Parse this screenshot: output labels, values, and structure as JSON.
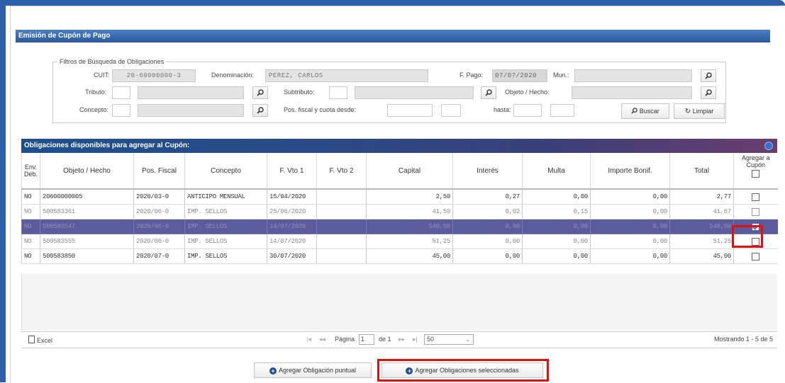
{
  "panel": {
    "title": "Emisión de Cupón de Pago"
  },
  "filters": {
    "legend": "Filtros de Búsqueda de Obligaciones",
    "cuit_label": "CUIT:",
    "cuit_value": "20-60000000-3",
    "denominacion_label": "Denominación:",
    "denominacion_value": "PEREZ, CARLOS",
    "fpago_label": "F. Pago:",
    "fpago_value": "07/07/2020",
    "mun_label": "Mun.:",
    "tributo_label": "Tributo:",
    "subtributo_label": "Subtributo:",
    "objeto_label": "Objeto / Hecho:",
    "concepto_label": "Concepto:",
    "posfiscal_label": "Pos. fiscal y cuota desde:",
    "hasta_label": "hasta:",
    "buscar_label": "Buscar",
    "limpiar_label": "Limpiar"
  },
  "grid": {
    "title": "Obligaciones disponibles para agregar al Cupón:",
    "columns": [
      "Env. Déb.",
      "Objeto / Hecho",
      "Pos. Fiscal",
      "Concepto",
      "F. Vto 1",
      "F. Vto 2",
      "Capital",
      "Interés",
      "Multa",
      "Importe Bonif.",
      "Total",
      "Agregar a Cupón"
    ],
    "rows": [
      {
        "env": "NO",
        "objeto": "20600000005",
        "pos": "2020/03-0",
        "concepto": "ANTICIPO MENSUAL",
        "fvto1": "15/04/2020",
        "fvto2": "",
        "capital": "2,50",
        "interes": "0,27",
        "multa": "0,00",
        "bonif": "0,00",
        "total": "2,77",
        "checked": false
      },
      {
        "env": "NO",
        "objeto": "500583361",
        "pos": "2020/06-0",
        "concepto": "IMP. SELLOS",
        "fvto1": "25/06/2020",
        "fvto2": "",
        "capital": "41,50",
        "interes": "0,02",
        "multa": "0,15",
        "bonif": "0,00",
        "total": "41,67",
        "checked": false
      },
      {
        "env": "NO",
        "objeto": "500583547",
        "pos": "2020/06-0",
        "concepto": "IMP. SELLOS",
        "fvto1": "14/07/2020",
        "fvto2": "",
        "capital": "540,00",
        "interes": "0,00",
        "multa": "0,00",
        "bonif": "0,00",
        "total": "540,00",
        "checked": true
      },
      {
        "env": "NO",
        "objeto": "500583555",
        "pos": "2020/06-0",
        "concepto": "IMP. SELLOS",
        "fvto1": "14/07/2020",
        "fvto2": "",
        "capital": "51,25",
        "interes": "0,00",
        "multa": "0,00",
        "bonif": "0,00",
        "total": "51,25",
        "checked": false
      },
      {
        "env": "NO",
        "objeto": "500583850",
        "pos": "2020/07-0",
        "concepto": "IMP. SELLOS",
        "fvto1": "30/07/2020",
        "fvto2": "",
        "capital": "45,00",
        "interes": "0,00",
        "multa": "0,00",
        "bonif": "0,00",
        "total": "45,00",
        "checked": false
      }
    ]
  },
  "pager": {
    "excel_label": "Excel",
    "pagina_label": "Página",
    "page_value": "1",
    "de_label": "de 1",
    "page_size": "50",
    "mostrando": "Mostrando 1 - 5 de 5"
  },
  "actions": {
    "puntual_label": "Agregar Obligación puntual",
    "seleccionadas_label": "Agregar Obligaciones seleccionadas"
  },
  "colors": {
    "selected_row": "#5c5c9c",
    "highlight": "#e01010",
    "title_bar": "#2a5a9a"
  }
}
